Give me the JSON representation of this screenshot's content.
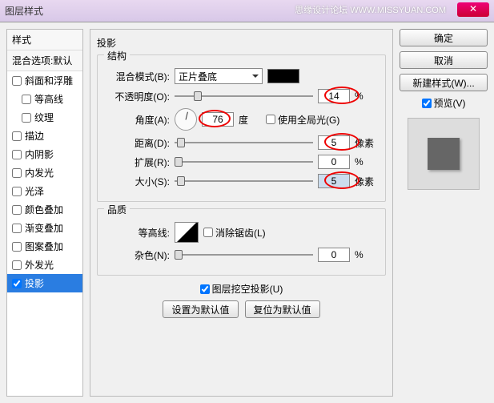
{
  "window": {
    "title": "图层样式",
    "watermark": "思缘设计论坛  WWW.MISSYUAN.COM"
  },
  "left": {
    "header": "样式",
    "blend_defaults": "混合选项:默认",
    "items": [
      {
        "label": "斜面和浮雕",
        "checked": false,
        "indent": false
      },
      {
        "label": "等高线",
        "checked": false,
        "indent": true
      },
      {
        "label": "纹理",
        "checked": false,
        "indent": true
      },
      {
        "label": "描边",
        "checked": false,
        "indent": false
      },
      {
        "label": "内阴影",
        "checked": false,
        "indent": false
      },
      {
        "label": "内发光",
        "checked": false,
        "indent": false
      },
      {
        "label": "光泽",
        "checked": false,
        "indent": false
      },
      {
        "label": "颜色叠加",
        "checked": false,
        "indent": false
      },
      {
        "label": "渐变叠加",
        "checked": false,
        "indent": false
      },
      {
        "label": "图案叠加",
        "checked": false,
        "indent": false
      },
      {
        "label": "外发光",
        "checked": false,
        "indent": false
      },
      {
        "label": "投影",
        "checked": true,
        "indent": false,
        "selected": true
      }
    ]
  },
  "mid": {
    "title": "投影",
    "structure": {
      "group": "结构",
      "blendmode_label": "混合模式(B):",
      "blendmode_value": "正片叠底",
      "opacity_label": "不透明度(O):",
      "opacity_value": "14",
      "opacity_unit": "%",
      "angle_label": "角度(A):",
      "angle_value": "76",
      "angle_unit": "度",
      "global_light": "使用全局光(G)",
      "distance_label": "距离(D):",
      "distance_value": "5",
      "distance_unit": "像素",
      "spread_label": "扩展(R):",
      "spread_value": "0",
      "spread_unit": "%",
      "size_label": "大小(S):",
      "size_value": "5",
      "size_unit": "像素"
    },
    "quality": {
      "group": "品质",
      "contour_label": "等高线:",
      "antialias": "消除锯齿(L)",
      "noise_label": "杂色(N):",
      "noise_value": "0",
      "noise_unit": "%"
    },
    "knockout": "图层挖空投影(U)",
    "btn_default": "设置为默认值",
    "btn_reset": "复位为默认值"
  },
  "right": {
    "ok": "确定",
    "cancel": "取消",
    "newstyle": "新建样式(W)...",
    "preview": "预览(V)"
  }
}
